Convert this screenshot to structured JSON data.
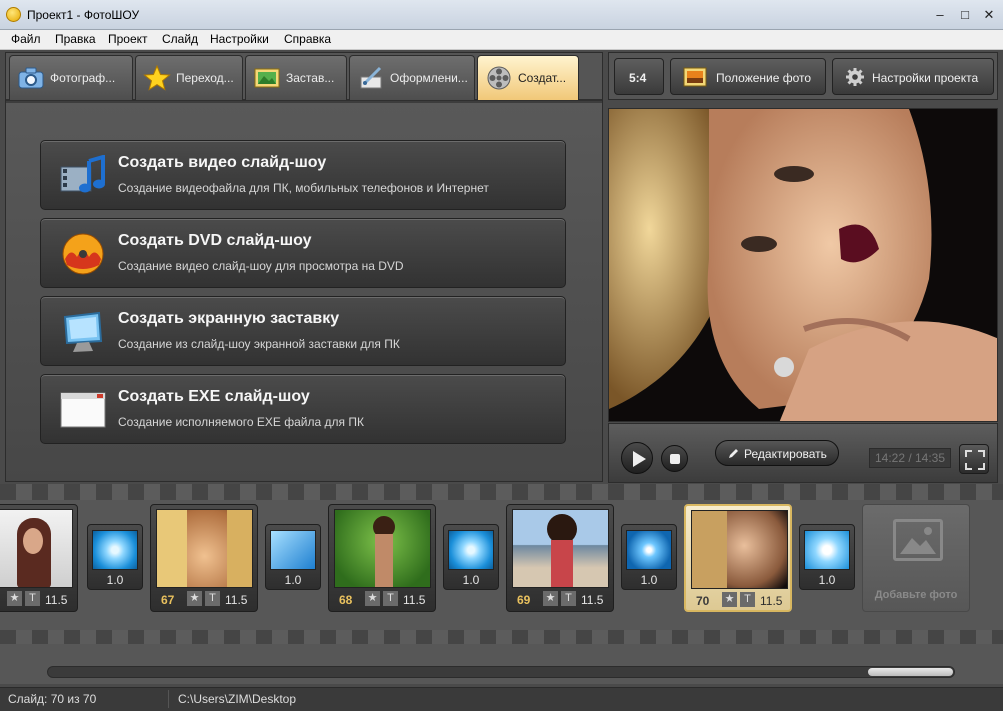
{
  "window": {
    "title": "Проект1 - ФотоШОУ"
  },
  "menu": [
    "Файл",
    "Правка",
    "Проект",
    "Слайд",
    "Настройки",
    "Справка"
  ],
  "tabs": [
    {
      "label": "Фотограф...",
      "icon": "camera-icon"
    },
    {
      "label": "Переход...",
      "icon": "star-icon"
    },
    {
      "label": "Застав...",
      "icon": "picture-icon"
    },
    {
      "label": "Оформлени...",
      "icon": "brush-icon"
    },
    {
      "label": "Создат...",
      "icon": "film-reel-icon",
      "active": true
    }
  ],
  "create_options": [
    {
      "title": "Создать видео слайд-шоу",
      "desc": "Создание видеофайла для ПК, мобильных телефонов и Интернет",
      "icon": "video-music-icon"
    },
    {
      "title": "Создать DVD слайд-шоу",
      "desc": "Создание видео слайд-шоу для просмотра на DVD",
      "icon": "dvd-disc-icon"
    },
    {
      "title": "Создать экранную заставку",
      "desc": "Создание из слайд-шоу экранной заставки для ПК",
      "icon": "monitor-icon"
    },
    {
      "title": "Создать EXE слайд-шоу",
      "desc": "Создание исполняемого EXE файла для ПК",
      "icon": "exe-window-icon"
    }
  ],
  "toolbar": {
    "aspect": "5:4",
    "photo_position": "Положение фото",
    "project_settings": "Настройки проекта"
  },
  "player": {
    "edit": "Редактировать",
    "time": "14:22 / 14:35"
  },
  "timeline": {
    "slides": [
      {
        "num": "",
        "duration": "11.5"
      },
      {
        "num": "67",
        "duration": "11.5"
      },
      {
        "num": "68",
        "duration": "11.5"
      },
      {
        "num": "69",
        "duration": "11.5"
      },
      {
        "num": "70",
        "duration": "11.5",
        "selected": true
      }
    ],
    "transitions": [
      "1.0",
      "1.0",
      "1.0",
      "1.0",
      "1.0"
    ],
    "add_photo": "Добавьте фото",
    "star_glyph": "★",
    "text_glyph": "T"
  },
  "status": {
    "slide": "Слайд: 70 из 70",
    "path": "C:\\Users\\ZIM\\Desktop"
  },
  "colors": {
    "active_tab": "#f1c878",
    "accent": "#e9c15e",
    "background": "#4a4a4a"
  }
}
